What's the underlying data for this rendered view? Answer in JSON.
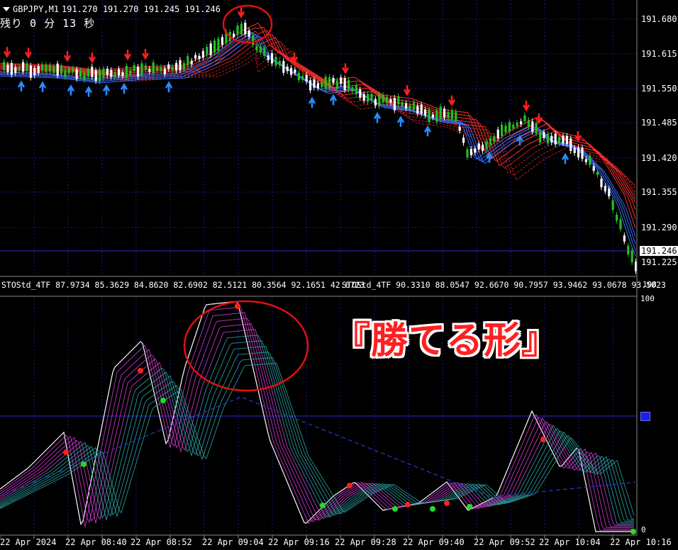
{
  "header": {
    "symbol_label": "GBPJPY,M1",
    "ohlc": "191.270 191.270 191.245 191.246",
    "timer": "残り 0 分 13 秒"
  },
  "price_axis": [
    "191.680",
    "191.615",
    "191.550",
    "191.485",
    "191.420",
    "191.355",
    "191.290",
    "191.225"
  ],
  "current_price": "191.246",
  "indicator_title_1": "STOStd_4TF 87.9734 85.3629 84.8620 82.6902 82.5121 80.3564 92.1651 42.6723",
  "indicator_title_2": "STOStd_4TF 90.3310 88.0547 92.6670 90.7957 93.9462 93.0678 93.5023",
  "indicator_scale": {
    "top_a": "108",
    "top_b": "100",
    "bottom": "0"
  },
  "time_axis": [
    "22 Apr 2024",
    "22 Apr 08:40",
    "22 Apr 08:52",
    "22 Apr 09:04",
    "22 Apr 09:16",
    "22 Apr 09:28",
    "22 Apr 09:40",
    "22 Apr 09:52",
    "22 Apr 10:04",
    "22 Apr 10:16"
  ],
  "annotation": "『勝てる形』",
  "colors": {
    "bull": "#22c022",
    "bear": "#ffffff",
    "up_arrow": "#2a8cff",
    "down_arrow": "#ff2020",
    "grid": "#1a1a7a",
    "circle": "#e01010"
  }
}
